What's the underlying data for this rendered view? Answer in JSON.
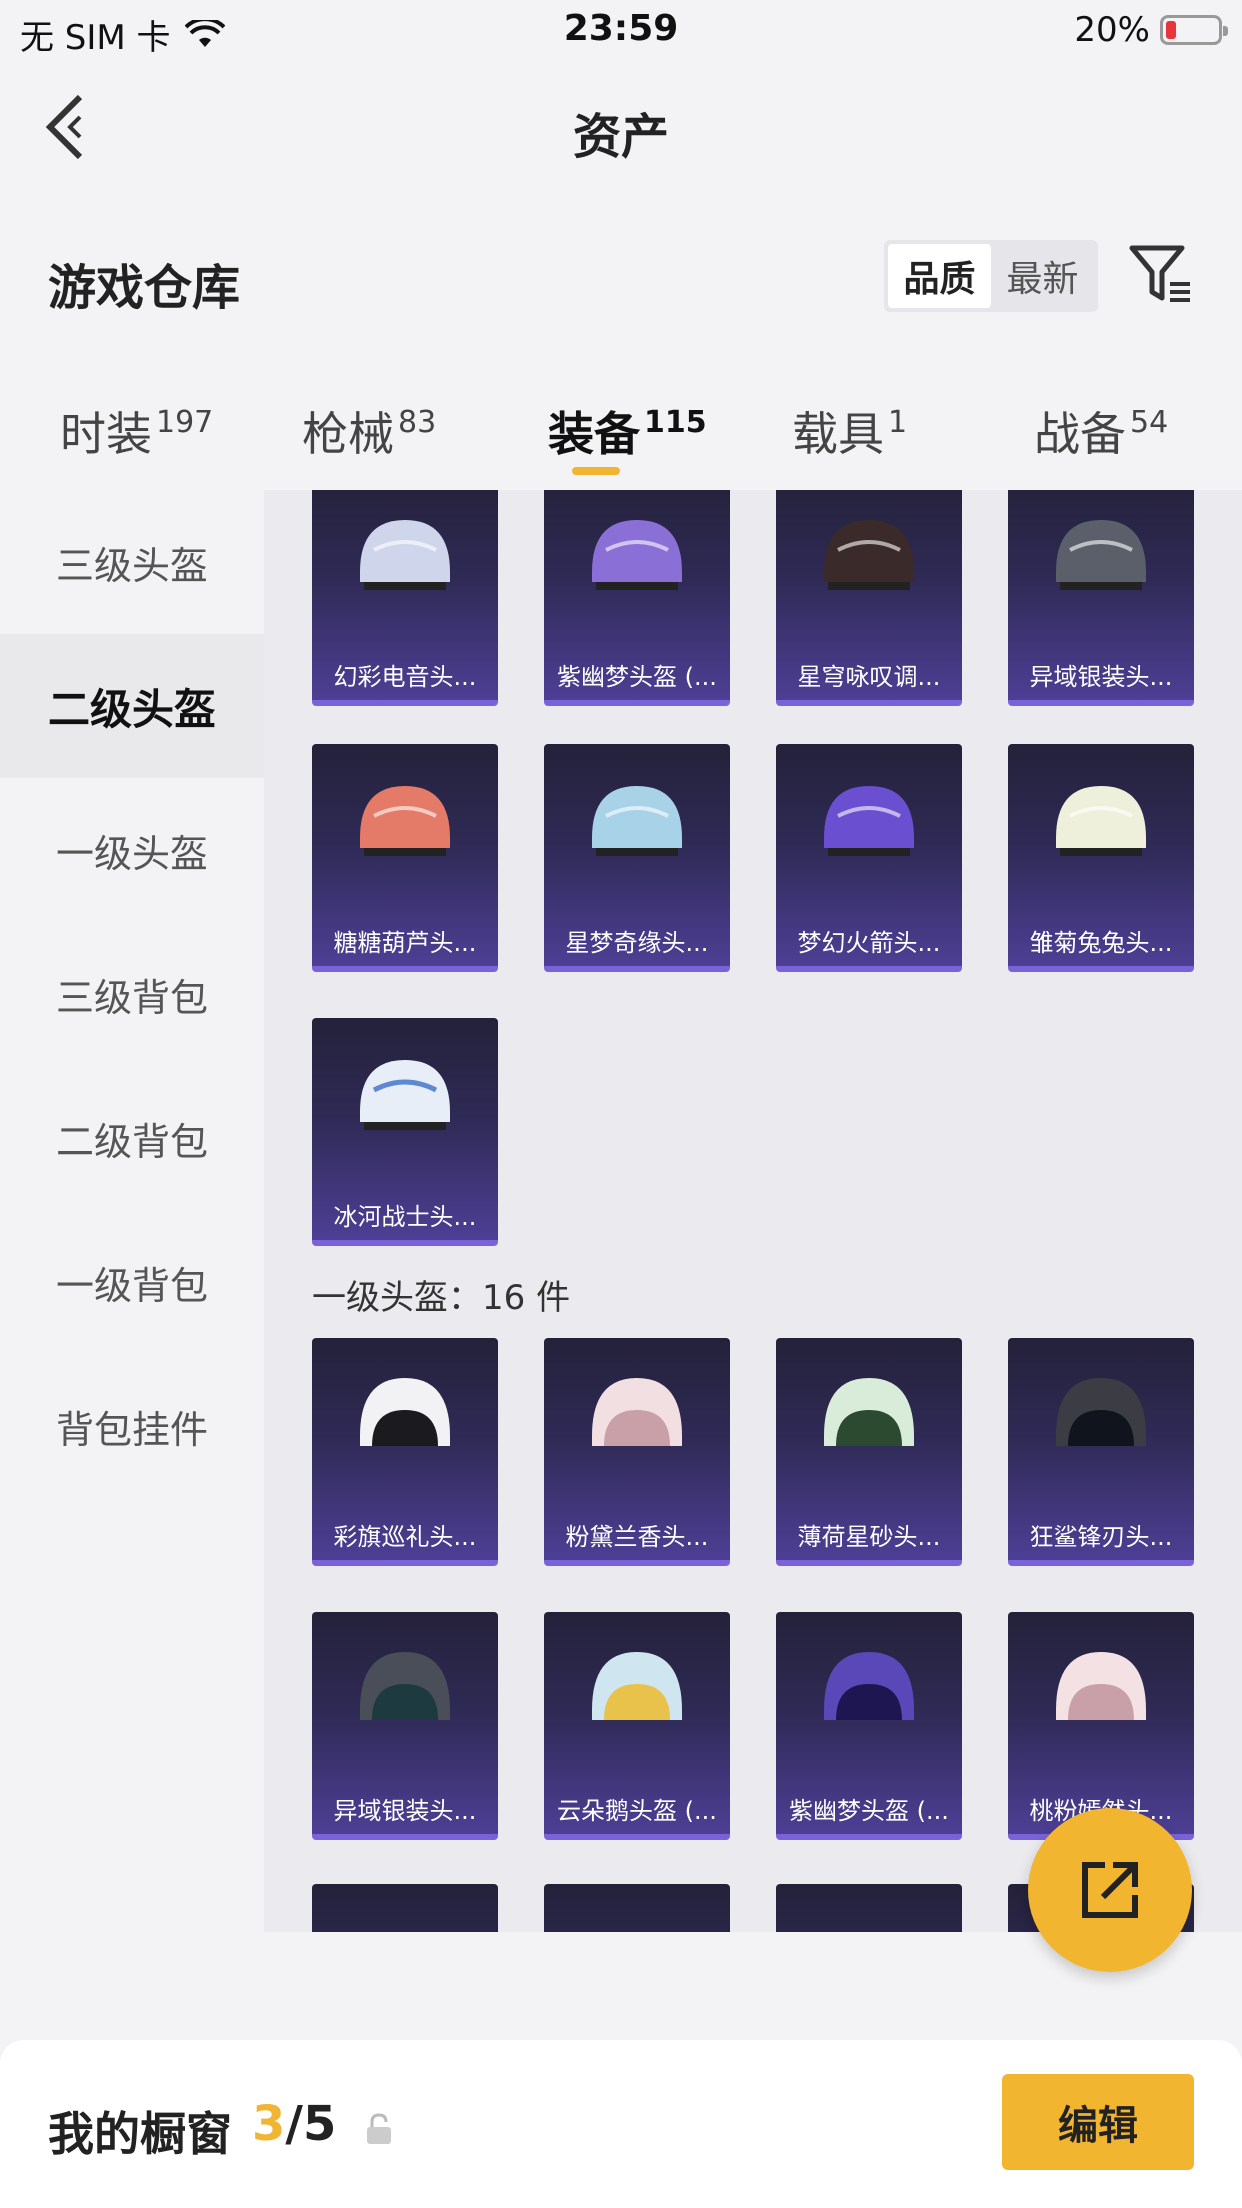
{
  "status_bar": {
    "carrier": "无 SIM 卡",
    "time": "23:59",
    "battery": "20%",
    "battery_level": 0.2
  },
  "nav": {
    "title": "资产"
  },
  "header": {
    "section_title": "游戏仓库",
    "sort_options": [
      "品质",
      "最新"
    ],
    "active_sort": "品质"
  },
  "tabs": [
    {
      "label": "时装",
      "count": "197"
    },
    {
      "label": "枪械",
      "count": "83"
    },
    {
      "label": "装备",
      "count": "115"
    },
    {
      "label": "载具",
      "count": "1"
    },
    {
      "label": "战备",
      "count": "54"
    }
  ],
  "active_tab": "装备",
  "sidebar": {
    "items": [
      "三级头盔",
      "二级头盔",
      "一级头盔",
      "三级背包",
      "二级背包",
      "一级背包",
      "背包挂件"
    ],
    "active": "二级头盔"
  },
  "groups": {
    "level2": {
      "items": [
        {
          "name": "幻彩电音头...",
          "color": "#cfd6ec"
        },
        {
          "name": "紫幽梦头盔 (...",
          "color": "#8a6fd6"
        },
        {
          "name": "星穹咏叹调...",
          "color": "#3a2a2a"
        },
        {
          "name": "异域银装头...",
          "color": "#5a5f6a"
        },
        {
          "name": "糖糖葫芦头...",
          "color": "#e47a68"
        },
        {
          "name": "星梦奇缘头...",
          "color": "#a8d2e8"
        },
        {
          "name": "梦幻火箭头...",
          "color": "#6a4fd0"
        },
        {
          "name": "雏菊兔兔头...",
          "color": "#eef0dc"
        },
        {
          "name": "冰河战士头...",
          "color": "#e8eef8"
        }
      ]
    },
    "level1": {
      "title": "一级头盔：16 件",
      "items": [
        {
          "name": "彩旗巡礼头...",
          "color": "#f2f2f4"
        },
        {
          "name": "粉黛兰香头...",
          "color": "#f1dfe2"
        },
        {
          "name": "薄荷星砂头...",
          "color": "#d8ecd9"
        },
        {
          "name": "狂鲨锋刃头...",
          "color": "#3c3c44"
        },
        {
          "name": "异域银装头...",
          "color": "#4a4e58"
        },
        {
          "name": "云朵鹅头盔 (...",
          "color": "#cfe6f0"
        },
        {
          "name": "紫幽梦头盔 (...",
          "color": "#5a48b8"
        },
        {
          "name": "桃粉嫣然头...",
          "color": "#f3e1e4"
        }
      ]
    }
  },
  "bottom": {
    "showcase_label": "我的橱窗",
    "showcase_current": "3",
    "showcase_total": "/5",
    "edit_label": "编辑"
  },
  "colors": {
    "accent": "#f2b52f",
    "card_bottom": "#7a63d8"
  }
}
